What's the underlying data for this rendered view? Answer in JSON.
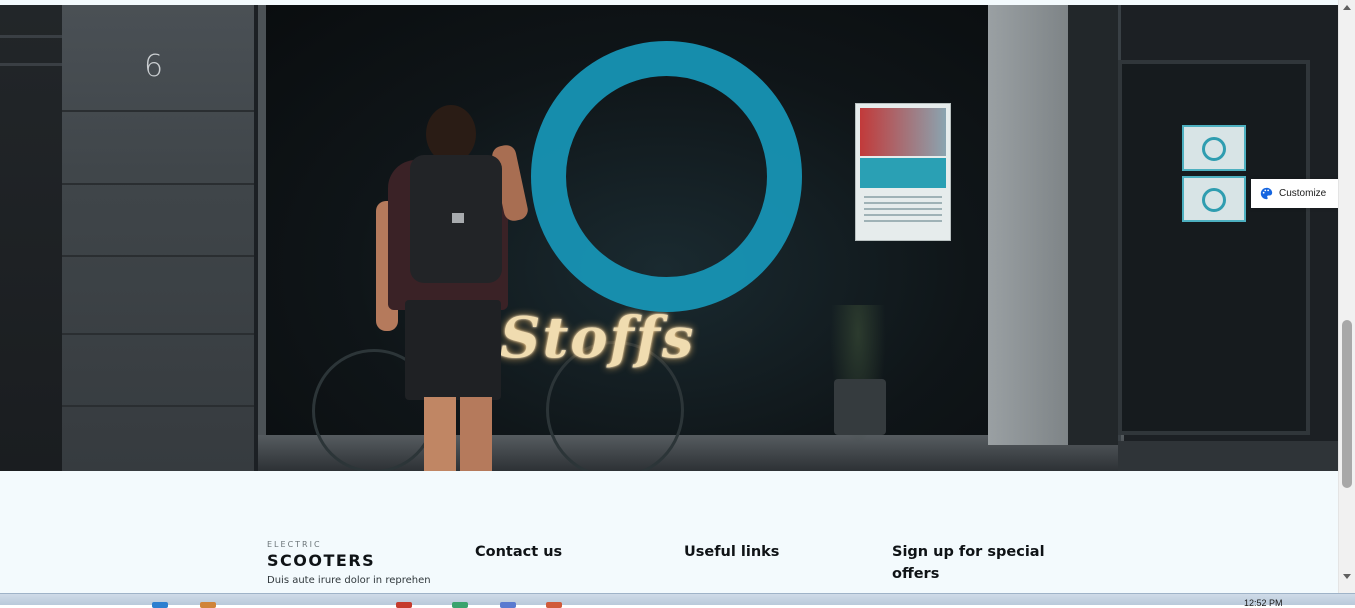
{
  "hero": {
    "house_number": "6",
    "neon_sign": "Stoffs"
  },
  "customize": {
    "label": "Customize",
    "icon": "palette-icon"
  },
  "footer": {
    "brand": {
      "kicker": "ELECTRIC",
      "name": "SCOOTERS",
      "description": "Duis aute irure dolor in reprehen"
    },
    "columns": [
      {
        "heading": "Contact us"
      },
      {
        "heading": "Useful links"
      },
      {
        "heading": "Sign up for special offers"
      }
    ]
  },
  "taskbar": {
    "time": "12:52 PM"
  },
  "colors": {
    "accent_ring": "#1794b4",
    "footer_bg": "#f3fafd",
    "heading_text": "#0f1316"
  }
}
